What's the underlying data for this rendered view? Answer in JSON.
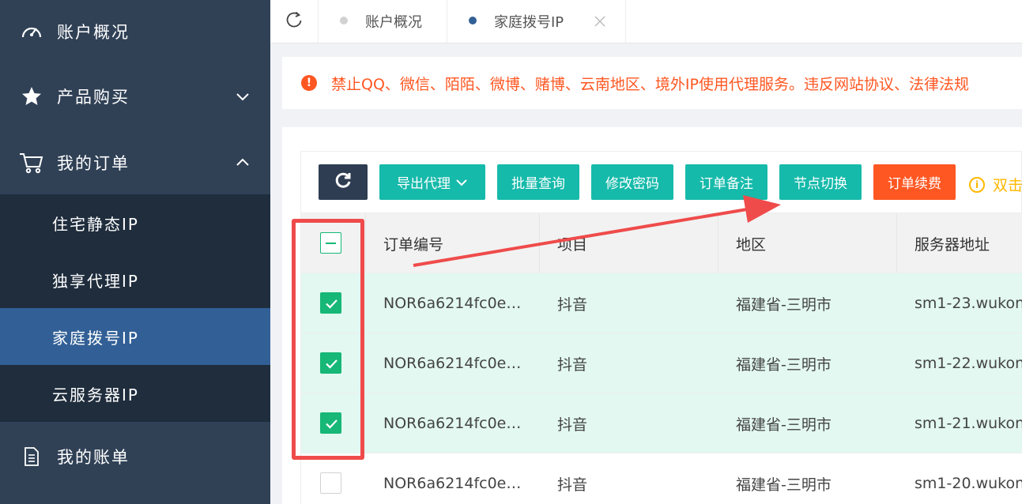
{
  "sidebar": {
    "items": [
      {
        "label": "账户概况",
        "icon": "dashboard-icon"
      },
      {
        "label": "产品购买",
        "icon": "star-icon",
        "arrow": "chevron-down-icon"
      },
      {
        "label": "我的订单",
        "icon": "cart-icon",
        "arrow": "chevron-up-icon"
      },
      {
        "label": "我的账单",
        "icon": "document-icon"
      }
    ],
    "sub_items": [
      {
        "label": "住宅静态IP"
      },
      {
        "label": "独享代理IP"
      },
      {
        "label": "家庭拨号IP",
        "active": true
      },
      {
        "label": "云服务器IP"
      }
    ]
  },
  "tabs": [
    {
      "label": "账户概况",
      "active": false
    },
    {
      "label": "家庭拨号IP",
      "active": true
    }
  ],
  "notice": {
    "text": "禁止QQ、微信、陌陌、微博、赌博、云南地区、境外IP使用代理服务。违反网站协议、法律法规"
  },
  "toolbar": {
    "export_label": "导出代理",
    "batch_query_label": "批量查询",
    "change_password_label": "修改密码",
    "order_note_label": "订单备注",
    "switch_node_label": "节点切换",
    "renew_label": "订单续费",
    "hint_text": "双击"
  },
  "table": {
    "headers": [
      "订单编号",
      "项目",
      "地区",
      "服务器地址"
    ],
    "rows": [
      {
        "order": "NOR6a6214fc0e…",
        "project": "抖音",
        "region": "福建省-三明市",
        "server": "sm1-23.wukon",
        "checked": true
      },
      {
        "order": "NOR6a6214fc0e…",
        "project": "抖音",
        "region": "福建省-三明市",
        "server": "sm1-22.wukon",
        "checked": true
      },
      {
        "order": "NOR6a6214fc0e…",
        "project": "抖音",
        "region": "福建省-三明市",
        "server": "sm1-21.wukon",
        "checked": true
      },
      {
        "order": "NOR6a6214fc0e…",
        "project": "抖音",
        "region": "福建省-三明市",
        "server": "sm1-20.wukon",
        "checked": false
      }
    ]
  },
  "colors": {
    "sidebar_bg": "#304156",
    "submenu_bg": "#1f2d3d",
    "active_item": "#326096",
    "teal_button": "#16baaa",
    "orange_button": "#ff5722",
    "checkbox_green": "#16b777",
    "selected_row": "#e2f8f0",
    "annotation_red": "#ef4b4b",
    "hint_yellow": "#ffb800"
  }
}
